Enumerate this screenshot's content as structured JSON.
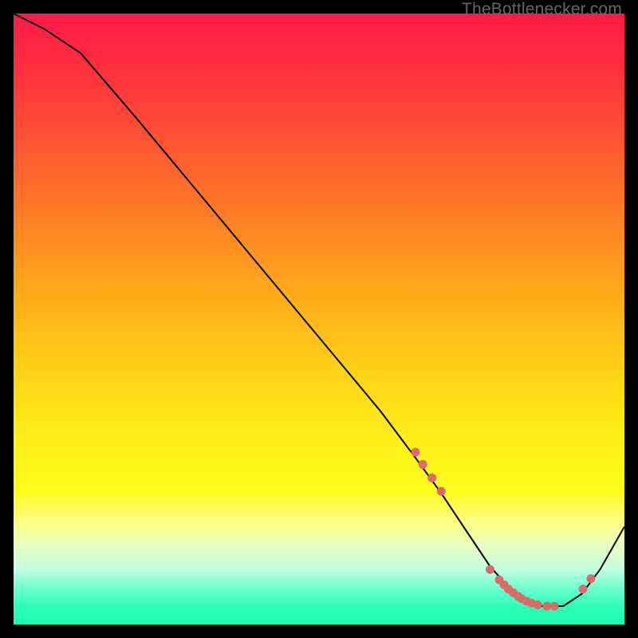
{
  "watermark": "TheBottlenecker.com",
  "chart_data": {
    "type": "line",
    "title": "",
    "xlabel": "",
    "ylabel": "",
    "xlim": [
      0,
      1
    ],
    "ylim": [
      0,
      1
    ],
    "background": "gradient-red-to-green",
    "series": [
      {
        "name": "bottleneck-curve",
        "x": [
          0.0,
          0.05,
          0.11,
          0.2,
          0.3,
          0.4,
          0.5,
          0.6,
          0.66,
          0.7,
          0.74,
          0.78,
          0.82,
          0.86,
          0.9,
          0.93,
          0.96,
          1.0
        ],
        "y": [
          1.0,
          0.975,
          0.935,
          0.83,
          0.71,
          0.59,
          0.47,
          0.35,
          0.27,
          0.215,
          0.155,
          0.095,
          0.05,
          0.03,
          0.03,
          0.05,
          0.09,
          0.16
        ]
      }
    ],
    "highlight_dots": {
      "x": [
        0.658,
        0.67,
        0.685,
        0.7,
        0.78,
        0.795,
        0.803,
        0.81,
        0.818,
        0.826,
        0.832,
        0.84,
        0.848,
        0.858,
        0.873,
        0.885,
        0.932,
        0.945
      ],
      "y": [
        0.282,
        0.262,
        0.24,
        0.218,
        0.09,
        0.073,
        0.065,
        0.058,
        0.052,
        0.046,
        0.042,
        0.038,
        0.035,
        0.032,
        0.03,
        0.03,
        0.058,
        0.075
      ]
    }
  }
}
